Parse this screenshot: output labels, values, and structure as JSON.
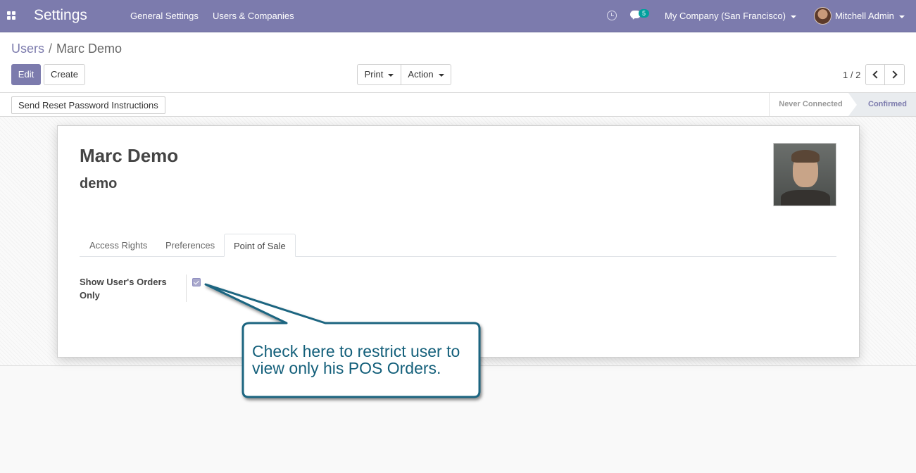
{
  "navbar": {
    "app_title": "Settings",
    "menu": [
      "General Settings",
      "Users & Companies"
    ],
    "message_count": "5",
    "company": "My Company (San Francisco)",
    "user": "Mitchell Admin",
    "colors": {
      "primary": "#7c7bad",
      "badge": "#00a09d"
    }
  },
  "breadcrumb": {
    "parent": "Users",
    "current": "Marc Demo"
  },
  "toolbar": {
    "edit_label": "Edit",
    "create_label": "Create",
    "print_label": "Print",
    "action_label": "Action",
    "pager": "1 / 2"
  },
  "statusbar": {
    "reset_label": "Send Reset Password Instructions",
    "stages": [
      "Never Connected",
      "Confirmed"
    ],
    "active_stage": "Confirmed"
  },
  "record": {
    "name": "Marc Demo",
    "login": "demo",
    "tabs": [
      "Access Rights",
      "Preferences",
      "Point of Sale"
    ],
    "active_tab": "Point of Sale",
    "field_label": "Show User's Orders Only",
    "field_checked": true
  },
  "annotation": {
    "text": "Check here to restrict user to view only his POS Orders.",
    "color": "#135f7a"
  }
}
